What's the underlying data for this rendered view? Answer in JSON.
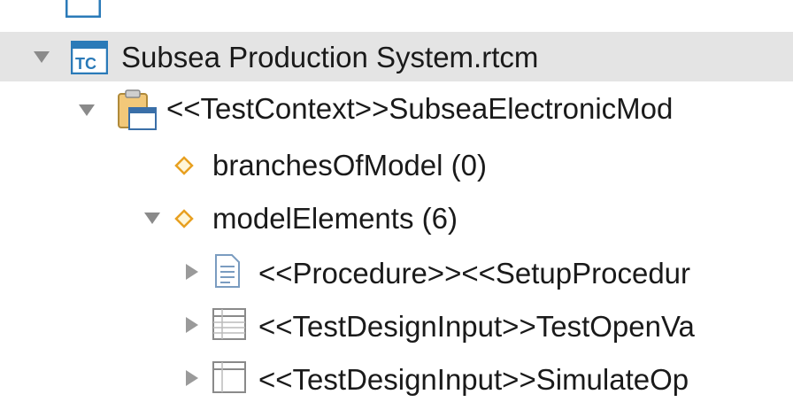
{
  "tree": {
    "partial_top_label": "",
    "root": {
      "label": "Subsea Production System.rtcm",
      "icon": "tc-file-icon",
      "expanded": true
    },
    "context": {
      "label": "<<TestContext>>SubseaElectronicMod",
      "icon": "clipboard-icon",
      "expanded": true
    },
    "branches": {
      "label": "branchesOfModel (0)",
      "icon": "diamond-icon"
    },
    "model_elements": {
      "label": "modelElements (6)",
      "icon": "diamond-icon",
      "expanded": true
    },
    "children": [
      {
        "label": "<<Procedure>><<SetupProcedur",
        "icon": "document-icon",
        "expanded": false
      },
      {
        "label": "<<TestDesignInput>>TestOpenVa",
        "icon": "table-icon",
        "expanded": false
      },
      {
        "label": "<<TestDesignInput>>SimulateOp",
        "icon": "table-icon",
        "expanded": false
      }
    ]
  },
  "colors": {
    "selection": "#e4e4e4",
    "tc_icon": "#2a7ab8",
    "diamond": "#e8a020"
  }
}
